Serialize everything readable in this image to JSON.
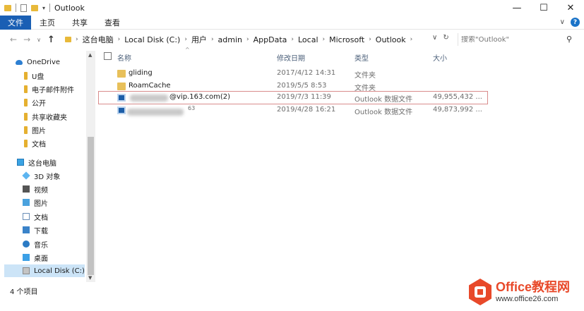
{
  "window": {
    "title": "Outlook",
    "minimize": "—",
    "maximize": "☐",
    "close": "✕"
  },
  "ribbon": {
    "tabs": [
      "文件",
      "主页",
      "共享",
      "查看"
    ],
    "collapse_chevron": "∨",
    "help": "?"
  },
  "address": {
    "crumbs": [
      "这台电脑",
      "Local Disk (C:)",
      "用户",
      "admin",
      "AppData",
      "Local",
      "Microsoft",
      "Outlook"
    ],
    "search_placeholder": "搜索\"Outlook\"",
    "separator": "›"
  },
  "sidebar": {
    "items": [
      {
        "label": "OneDrive",
        "icon": "onedrive-cloud-icon"
      },
      {
        "label": "U盘",
        "icon": "pin-folder-icon"
      },
      {
        "label": "电子邮件附件",
        "icon": "pin-folder-icon"
      },
      {
        "label": "公开",
        "icon": "pin-folder-icon"
      },
      {
        "label": "共享收藏夹",
        "icon": "pin-folder-icon"
      },
      {
        "label": "图片",
        "icon": "pin-folder-icon"
      },
      {
        "label": "文档",
        "icon": "pin-folder-icon"
      },
      {
        "label": "这台电脑",
        "icon": "this-pc-icon"
      },
      {
        "label": "3D 对象",
        "icon": "3d-objects-icon"
      },
      {
        "label": "视频",
        "icon": "video-icon"
      },
      {
        "label": "图片",
        "icon": "pictures-icon"
      },
      {
        "label": "文档",
        "icon": "documents-icon"
      },
      {
        "label": "下载",
        "icon": "downloads-icon"
      },
      {
        "label": "音乐",
        "icon": "music-icon"
      },
      {
        "label": "桌面",
        "icon": "desktop-icon"
      },
      {
        "label": "Local Disk (C:)",
        "icon": "local-disk-icon"
      }
    ]
  },
  "columns": {
    "name": "名称",
    "modified": "修改日期",
    "type": "类型",
    "size": "大小"
  },
  "files": [
    {
      "name": "gliding",
      "modified": "2017/4/12 14:31",
      "type": "文件夹",
      "size": "",
      "kind": "folder"
    },
    {
      "name": "RoamCache",
      "modified": "2019/5/5 8:53",
      "type": "文件夹",
      "size": "",
      "kind": "folder"
    },
    {
      "name": "@vip.163.com(2)",
      "modified": "2019/7/3 11:39",
      "type": "Outlook 数据文件",
      "size": "49,955,432 ...",
      "kind": "pst"
    },
    {
      "name": "63",
      "modified": "2019/4/28 16:21",
      "type": "Outlook 数据文件",
      "size": "49,873,992 ...",
      "kind": "pst"
    }
  ],
  "status": {
    "item_count": "4 个项目"
  },
  "watermark": {
    "brand": "Office教程网",
    "url": "www.office26.com"
  }
}
